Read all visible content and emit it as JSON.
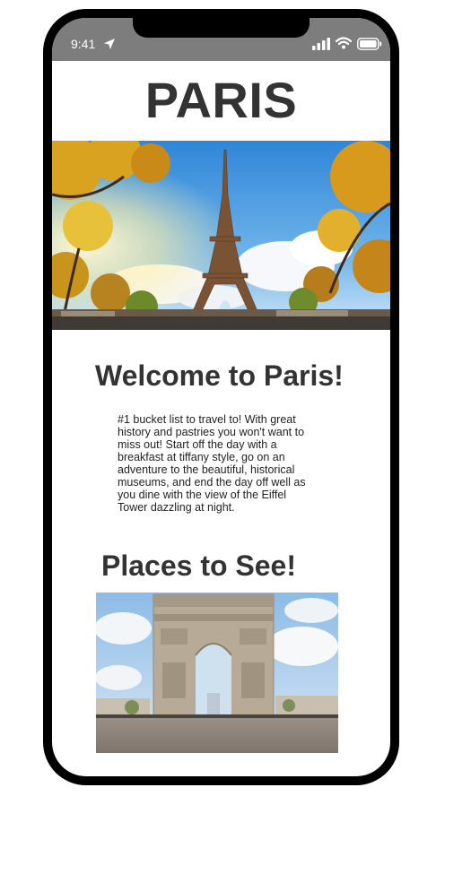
{
  "status_bar": {
    "time": "9:41",
    "background_color": "#7d7d7d",
    "icons": [
      "location-arrow-icon",
      "cellular-signal-icon",
      "wifi-icon",
      "battery-icon"
    ]
  },
  "page": {
    "title": "PARIS",
    "title_color": "#333333"
  },
  "hero_image": {
    "subject": "eiffel-tower-photo"
  },
  "welcome": {
    "heading": "Welcome to Paris!",
    "text_lines": [
      "#1 bucket list to travel to! With great",
      "history and pastries you won't want to",
      "miss out! Start off the day with a",
      "breakfast at tiffany style, go on an",
      "adventure to the beautiful, historical",
      "museums, and end the day off well as",
      "you dine with the view of the Eiffel",
      "Tower dazzling at night."
    ]
  },
  "places": {
    "heading": "Places to See!",
    "images": [
      {
        "subject": "arc-de-triomphe-photo"
      }
    ]
  }
}
